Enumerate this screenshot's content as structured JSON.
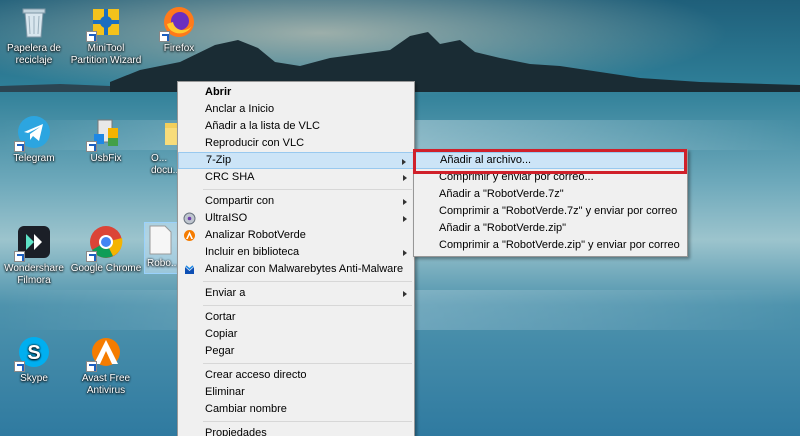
{
  "desktop": {
    "icons": [
      {
        "label": "Papelera de reciclaje"
      },
      {
        "label": "MiniTool Partition Wizard"
      },
      {
        "label": "Firefox"
      },
      {
        "label": "Telegram"
      },
      {
        "label": "UsbFix"
      },
      {
        "label": "O... docu..."
      },
      {
        "label": "Wondershare Filmora"
      },
      {
        "label": "Google Chrome"
      },
      {
        "label": "Robo..."
      },
      {
        "label": "Skype"
      },
      {
        "label": "Avast Free Antivirus"
      }
    ]
  },
  "context_menu": {
    "items": {
      "abrir": "Abrir",
      "anclar": "Anclar a Inicio",
      "vlc_add": "Añadir a la lista de VLC",
      "vlc_play": "Reproducir con VLC",
      "zip": "7-Zip",
      "crc": "CRC SHA",
      "compartir": "Compartir con",
      "ultraiso": "UltraISO",
      "analizar": "Analizar RobotVerde",
      "biblioteca": "Incluir en biblioteca",
      "malware": "Analizar con Malwarebytes Anti-Malware",
      "enviar": "Enviar a",
      "cortar": "Cortar",
      "copiar": "Copiar",
      "pegar": "Pegar",
      "acceso": "Crear acceso directo",
      "eliminar": "Eliminar",
      "renombrar": "Cambiar nombre",
      "propiedades": "Propiedades"
    }
  },
  "submenu_7zip": {
    "items": [
      "Añadir al archivo...",
      "Comprimir y enviar por correo...",
      "Añadir a \"RobotVerde.7z\"",
      "Comprimir a \"RobotVerde.7z\" y enviar por correo",
      "Añadir a \"RobotVerde.zip\"",
      "Comprimir a \"RobotVerde.zip\" y enviar por correo"
    ]
  },
  "colors": {
    "highlight_bg": "#cce4f7",
    "highlight_border": "#99c9ef",
    "focus_outline": "#d0202a"
  }
}
